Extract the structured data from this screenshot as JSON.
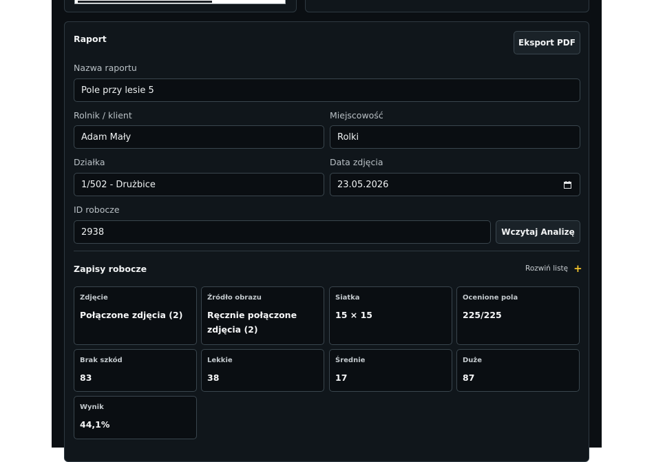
{
  "report": {
    "title": "Raport",
    "export_button": "Eksport PDF",
    "fields": {
      "report_name": {
        "label": "Nazwa raportu",
        "value": "Pole przy lesie 5"
      },
      "farmer": {
        "label": "Rolnik / klient",
        "value": "Adam Mały"
      },
      "locality": {
        "label": "Miejscowość",
        "value": "Rolki"
      },
      "parcel": {
        "label": "Działka",
        "value": "1/502 - Drużbice"
      },
      "photo_date": {
        "label": "Data zdjęcia",
        "value": "23.05.2026"
      },
      "draft_id": {
        "label": "ID robocze",
        "value": "2938"
      }
    },
    "load_button": "Wczytaj Analizę"
  },
  "drafts": {
    "title": "Zapisy robocze",
    "expand_label": "Rozwiń listę",
    "expand_icon": "plus-icon",
    "accent_color": "#f2c32b",
    "stats": [
      {
        "label": "Zdjęcie",
        "value": "Połączone zdjęcia (2)"
      },
      {
        "label": "Źródło obrazu",
        "value": "Ręcznie połączone zdjęcia (2)"
      },
      {
        "label": "Siatka",
        "value": "15 × 15"
      },
      {
        "label": "Ocenione pola",
        "value": "225/225"
      },
      {
        "label": "Brak szkód",
        "value": "83"
      },
      {
        "label": "Lekkie",
        "value": "38"
      },
      {
        "label": "Średnie",
        "value": "17"
      },
      {
        "label": "Duże",
        "value": "87"
      },
      {
        "label": "Wynik",
        "value": "44,1%"
      }
    ]
  }
}
